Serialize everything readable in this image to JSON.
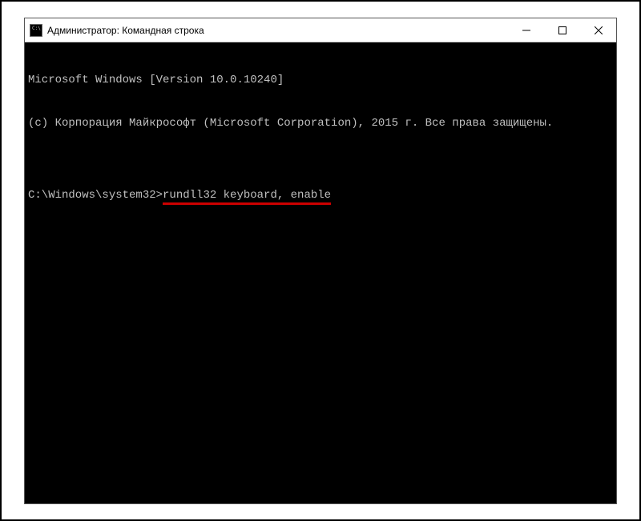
{
  "window": {
    "title": "Администратор: Командная строка"
  },
  "console": {
    "line1": "Microsoft Windows [Version 10.0.10240]",
    "line2": "(c) Корпорация Майкрософт (Microsoft Corporation), 2015 г. Все права защищены.",
    "blank": "",
    "prompt": "C:\\Windows\\system32>",
    "command": "rundll32 keyboard, enable"
  }
}
